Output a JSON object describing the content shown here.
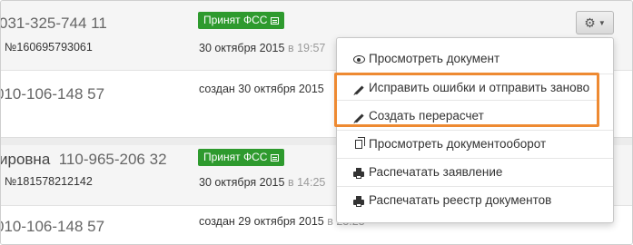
{
  "rows": [
    {
      "phone": "031-325-744 11",
      "status_badge": "Принят ФСС",
      "number": "№160695793061",
      "date": "30 октября 2015",
      "time_prefix": "в",
      "time": "19:57"
    },
    {
      "phone": "010-106-148 57",
      "created": "создан 30 октября 2015"
    },
    {
      "name_fragment": "ировна",
      "phone": "110-965-206 32",
      "status_badge": "Принят ФСС",
      "number": "№181578212142",
      "date": "30 октября 2015",
      "time_prefix": "в",
      "time": "14:25"
    },
    {
      "phone": "010-106-148 57",
      "created": "создан 29 октября 2015",
      "time_prefix": "в",
      "time": "23:23"
    }
  ],
  "actions_button": {
    "icon": "gear-icon",
    "caret": "caret-down-icon"
  },
  "menu": {
    "items": [
      {
        "label": "Просмотреть документ",
        "icon": "eye-icon"
      },
      {
        "label": "Исправить ошибки и отправить заново",
        "icon": "pencil-icon"
      },
      {
        "label": "Создать перерасчет",
        "icon": "pencil-icon"
      },
      {
        "label": "Просмотреть документооборот",
        "icon": "documents-icon"
      },
      {
        "label": "Распечатать заявление",
        "icon": "printer-icon"
      },
      {
        "label": "Распечатать реестр документов",
        "icon": "printer-icon"
      }
    ]
  },
  "colors": {
    "badge": "#2e9a2e",
    "highlight": "#ee8a32",
    "panel": "#f6f6f6"
  }
}
